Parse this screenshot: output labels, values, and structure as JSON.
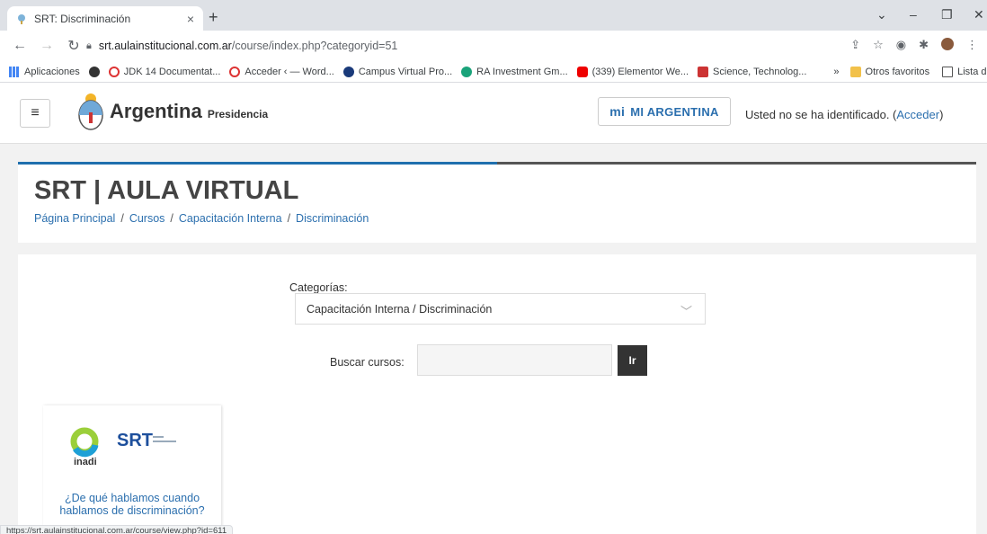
{
  "browser": {
    "tab_title": "SRT: Discriminación",
    "tab_close": "×",
    "new_tab": "+",
    "url_host": "srt.aulainstitucional.com.ar",
    "url_path": "/course/index.php?categoryid=51",
    "status_url": "https://srt.aulainstitucional.com.ar/course/view.php?id=611",
    "bookmarks": [
      "Aplicaciones",
      "JDK 14 Documentat...",
      "Acceder ‹ — Word...",
      "Campus Virtual Pro...",
      "RA Investment Gm...",
      "(339) Elementor We...",
      "Science, Technolog...",
      "»",
      "Otros favoritos",
      "Lista de lectura"
    ]
  },
  "site": {
    "brand": "Argentina",
    "brand_sub": "Presidencia",
    "mi_argentina": "MI ARGENTINA",
    "mi_prefix": "mi",
    "login_text": "Usted no se ha identificado. (",
    "login_link": "Acceder",
    "login_close": ")"
  },
  "header": {
    "title": "SRT | AULA VIRTUAL",
    "breadcrumb": [
      "Página Principal",
      "Cursos",
      "Capacitación Interna",
      "Discriminación"
    ],
    "sep": "/"
  },
  "main": {
    "categories_label": "Categorías:",
    "categories_value": "Capacitación Interna / Discriminación",
    "search_label": "Buscar cursos:",
    "go_label": "Ir"
  },
  "course": {
    "org1": "inadi",
    "org2": "SRT",
    "name": "¿De qué hablamos cuando hablamos de discriminación?"
  },
  "colors": {
    "link": "#2b6fae",
    "accent_bar": "#1f6fae",
    "button_dark": "#333333"
  }
}
